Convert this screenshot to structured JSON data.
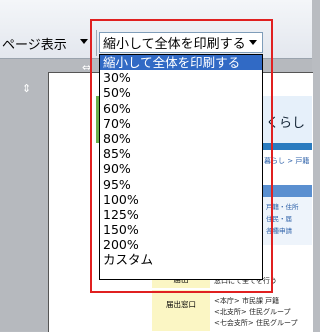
{
  "toolbar": {
    "view_mode_label": "ページ表示"
  },
  "scale": {
    "current": "縮小して全体を印刷する",
    "options": [
      "縮小して全体を印刷する",
      "30%",
      "50%",
      "60%",
      "70%",
      "80%",
      "85%",
      "90%",
      "95%",
      "100%",
      "125%",
      "150%",
      "200%",
      "カスタム"
    ],
    "selected_index": 0
  },
  "preview": {
    "banner_title": "くらし",
    "crumb_text": "暮らし > 戸籍",
    "panel_lines": [
      "戸籍・住所",
      "住民・届",
      "各種申請"
    ],
    "table_rows": [
      {
        "label": "届出",
        "text": "窓口にて全てを行う"
      },
      {
        "label": "届出窓口",
        "text": "<本庁> 市民課 戸籍"
      }
    ],
    "extra_lines": [
      "<北支所> 住民グループ",
      "<七会支所> 住民グループ"
    ]
  },
  "colors": {
    "highlight": "#e02020",
    "selection": "#316ac5"
  }
}
